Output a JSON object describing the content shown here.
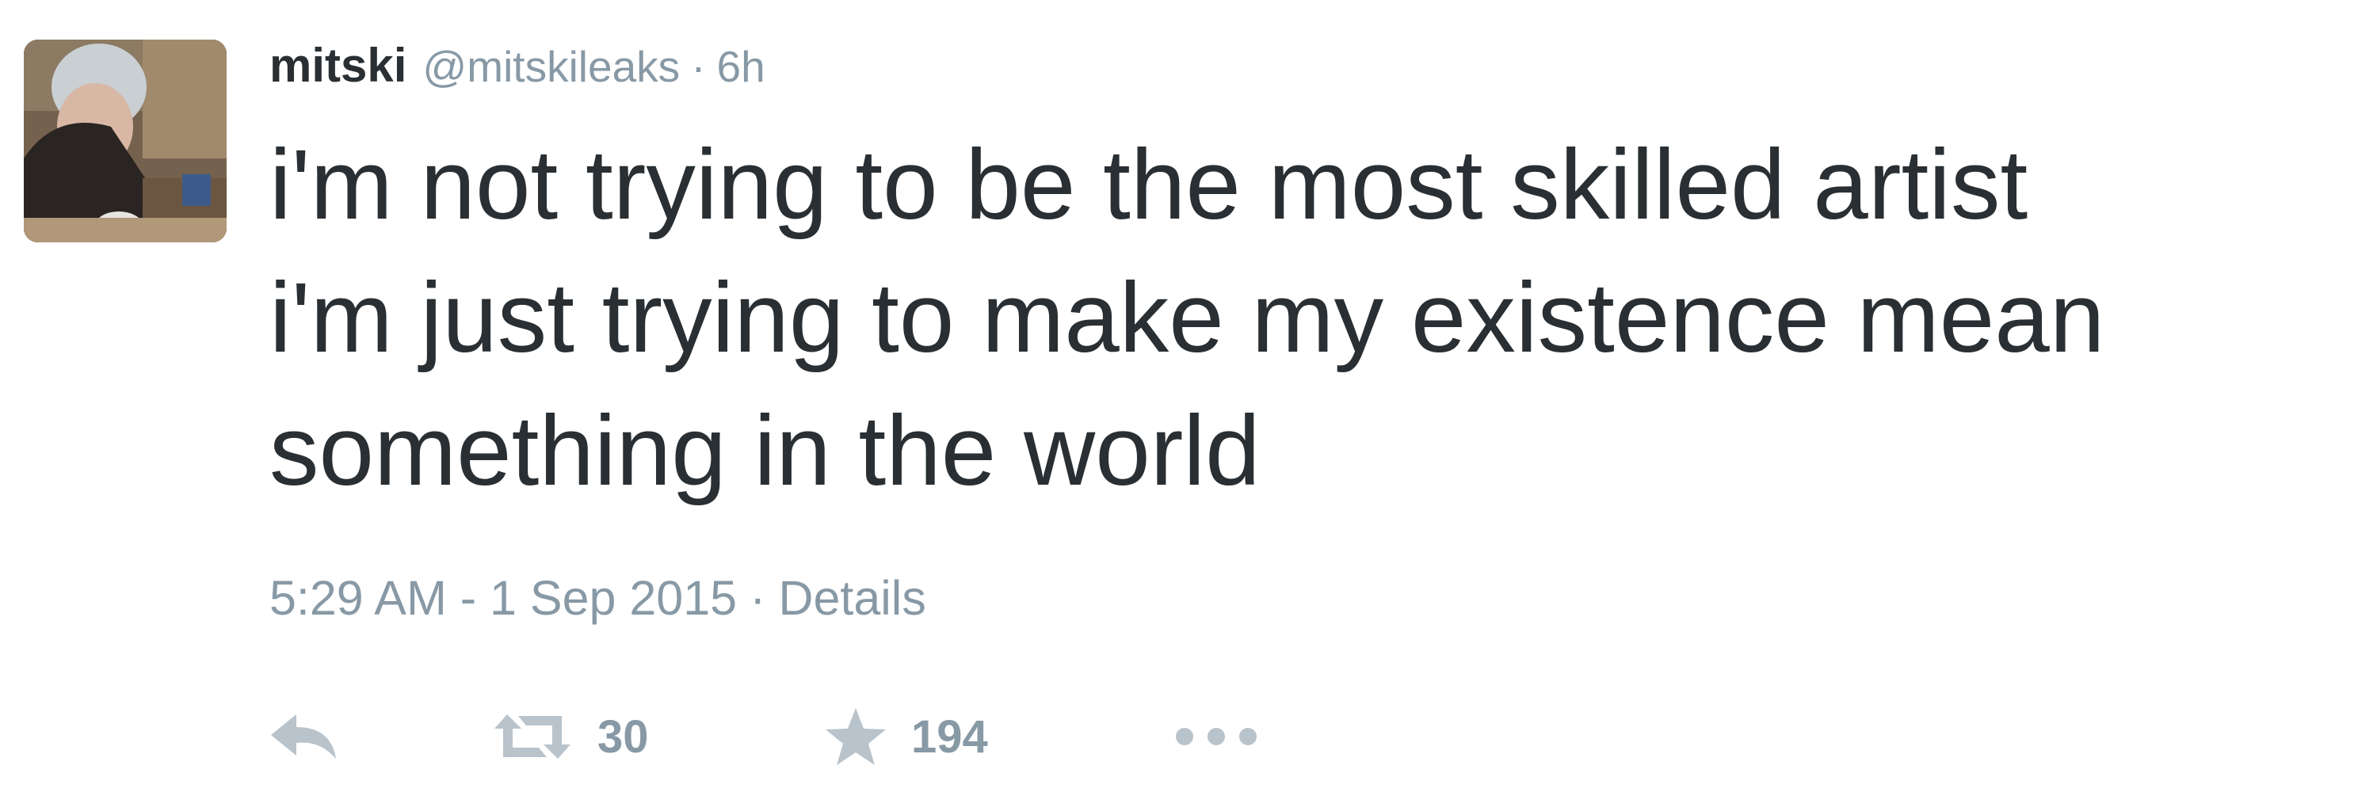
{
  "tweet": {
    "author": {
      "name": "mitski",
      "handle": "@mitskileaks",
      "separator": "·",
      "relative_time": "6h",
      "avatar_icon": "profile-photo"
    },
    "text_lines": [
      "i'm not trying to be the most skilled artist",
      "i'm just trying to make my existence mean",
      "something in the world"
    ],
    "meta": {
      "timestamp": "5:29 AM - 1 Sep 2015",
      "separator": "·",
      "details_label": "Details"
    },
    "actions": {
      "reply_icon": "reply-icon",
      "retweet_icon": "retweet-icon",
      "retweet_count": "30",
      "favorite_icon": "star-icon",
      "favorite_count": "194",
      "more_icon": "more-icon"
    },
    "colors": {
      "text": "#292f33",
      "muted": "#8899a6",
      "icon": "#b8c3cc"
    }
  }
}
